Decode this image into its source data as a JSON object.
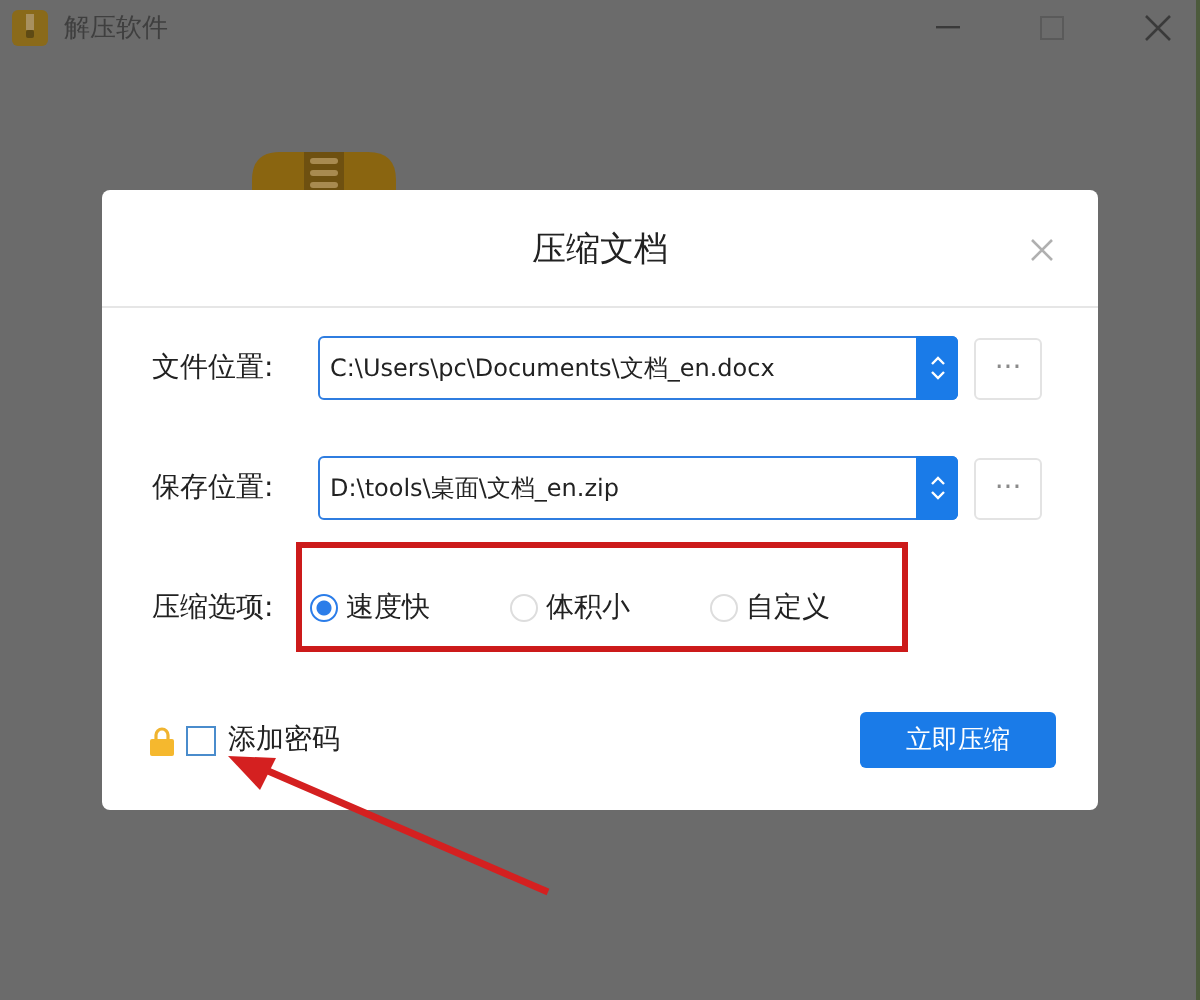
{
  "window": {
    "title": "解压软件"
  },
  "dialog": {
    "title": "压缩文档",
    "fields": [
      {
        "label": "文件位置:",
        "value": "C:\\Users\\pc\\Documents\\文档_en.docx",
        "browse": "···"
      },
      {
        "label": "保存位置:",
        "value": "D:\\tools\\桌面\\文档_en.zip",
        "browse": "···"
      }
    ],
    "option_label": "压缩选项:",
    "options": [
      {
        "label": "速度快",
        "selected": true
      },
      {
        "label": "体积小",
        "selected": false
      },
      {
        "label": "自定义",
        "selected": false
      }
    ],
    "options_highlighted": true,
    "password": {
      "label": "添加密码",
      "checked": false,
      "pointed_at": true
    },
    "submit": "立即压缩"
  }
}
